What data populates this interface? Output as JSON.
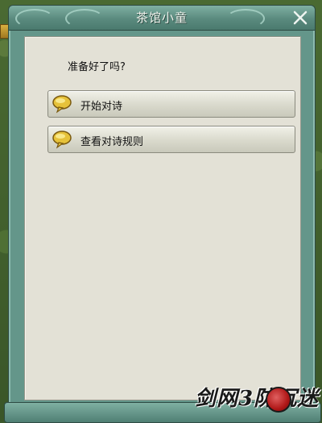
{
  "dialog": {
    "title": "茶馆小童",
    "prompt": "准备好了吗?",
    "options": [
      {
        "label": "开始对诗",
        "icon": "speech-bubble-icon"
      },
      {
        "label": "查看对诗规则",
        "icon": "speech-bubble-icon"
      }
    ],
    "close_icon": "close-icon"
  },
  "watermark": {
    "text": "剑网3防沉迷",
    "icon": "logo-emblem"
  },
  "colors": {
    "frame": "#64968a",
    "title_bar": "#5a8a7e",
    "content_bg": "#e3e1d6",
    "button_bg": "#d9d9cc",
    "bubble_yellow": "#e6c23a"
  }
}
